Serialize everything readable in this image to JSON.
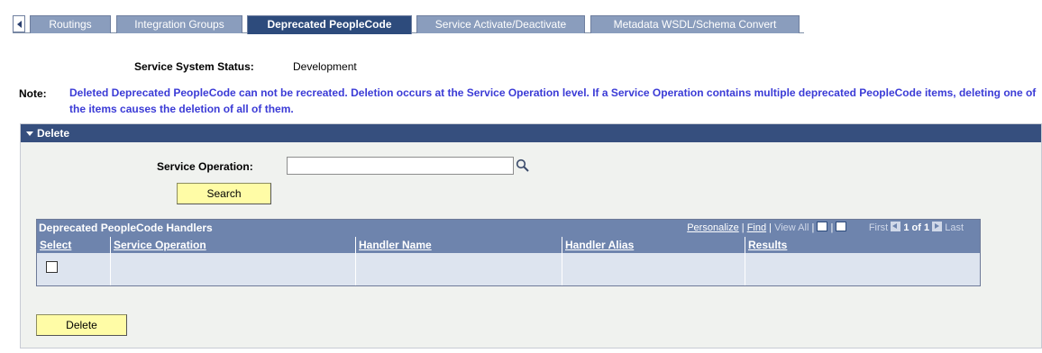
{
  "tabs": [
    {
      "label": "Routings",
      "active": false
    },
    {
      "label": "Integration Groups",
      "active": false
    },
    {
      "label": "Deprecated PeopleCode",
      "active": true
    },
    {
      "label": "Service Activate/Deactivate",
      "active": false
    },
    {
      "label": "Metadata WSDL/Schema Convert",
      "active": false
    }
  ],
  "status": {
    "label": "Service System Status:",
    "value": "Development"
  },
  "note": {
    "label": "Note:",
    "text": "Deleted Deprecated PeopleCode can not be recreated.  Deletion occurs at the Service Operation level.  If a Service Operation contains multiple deprecated PeopleCode items, deleting one of the items causes the deletion of all of them."
  },
  "delete_section": {
    "title": "Delete",
    "service_operation_label": "Service Operation:",
    "service_operation_value": "",
    "search_button": "Search",
    "delete_button": "Delete"
  },
  "grid": {
    "title": "Deprecated PeopleCode Handlers",
    "nav": {
      "personalize": "Personalize",
      "separator": "|",
      "find": "Find",
      "view_all": "View All",
      "first": "First",
      "count": "1 of 1",
      "last": "Last"
    },
    "columns": [
      "Select",
      "Service Operation",
      "Handler Name",
      "Handler Alias",
      "Results"
    ],
    "rows": [
      {
        "select": false,
        "service_operation": "",
        "handler_name": "",
        "handler_alias": "",
        "results": ""
      }
    ]
  },
  "colors": {
    "tab_inactive": "#8a9dbd",
    "tab_active": "#2d4b7c",
    "panel_header": "#364f7e",
    "note_text": "#3b3bd6",
    "button_bg": "#fffca6",
    "grid_header": "#6e84ad"
  }
}
